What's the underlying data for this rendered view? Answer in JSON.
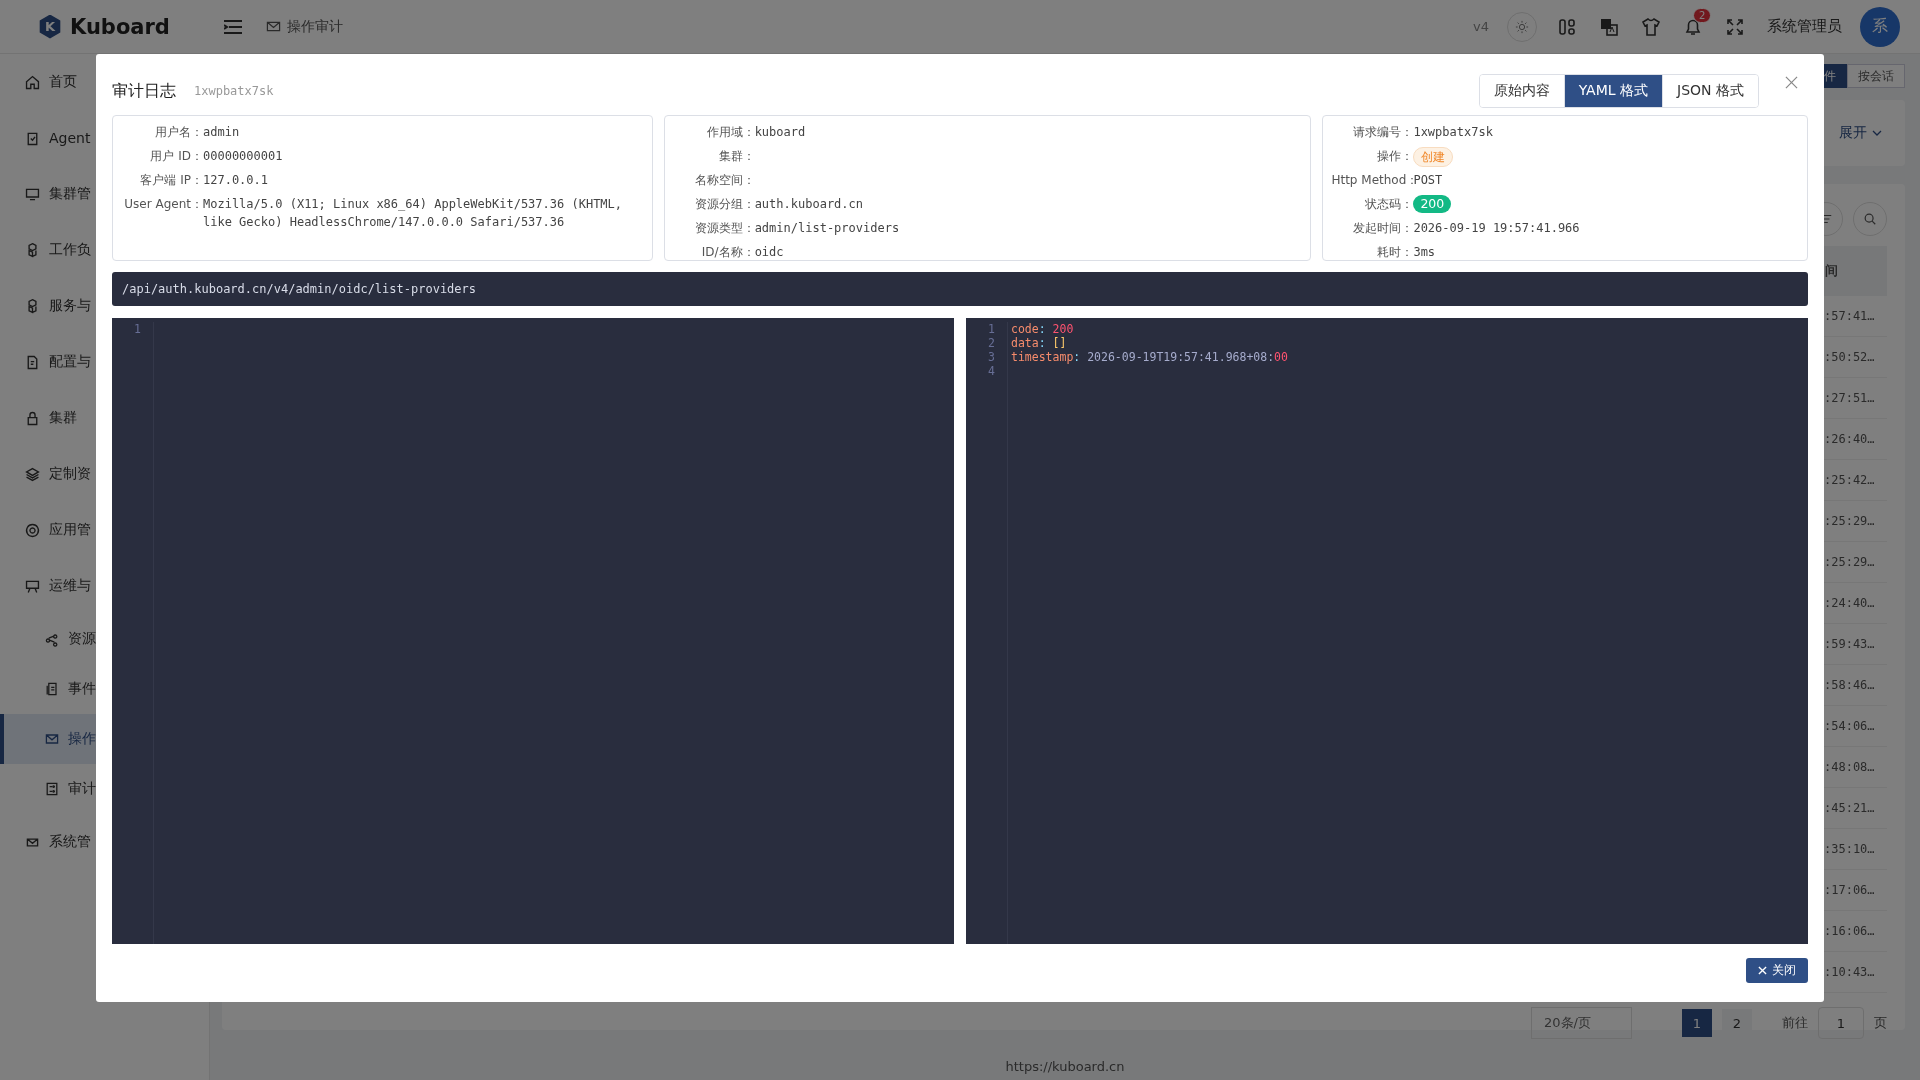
{
  "header": {
    "logo_mark": "K",
    "logo": "Kuboard",
    "breadcrumb": "操作审计",
    "version": "v4",
    "notifications": "2",
    "user": "系统管理员",
    "avatar": "系"
  },
  "sidebar": {
    "items": [
      {
        "label": "首页",
        "selected": false
      },
      {
        "label": "Agent",
        "selected": false
      },
      {
        "label": "集群管",
        "selected": false
      },
      {
        "label": "工作负",
        "selected": false
      },
      {
        "label": "服务与",
        "selected": false
      },
      {
        "label": "配置与",
        "selected": false
      },
      {
        "label": "集群",
        "selected": false
      },
      {
        "label": "定制资",
        "selected": false
      },
      {
        "label": "应用管",
        "selected": false
      },
      {
        "label": "运维与",
        "selected": false,
        "children": [
          {
            "label": "资源",
            "selected": false
          },
          {
            "label": "事件",
            "selected": false
          },
          {
            "label": "操作",
            "selected": true
          },
          {
            "label": "审计",
            "selected": false
          }
        ]
      },
      {
        "label": "系统管",
        "selected": false
      }
    ]
  },
  "background": {
    "view_tabs": [
      {
        "label": "件",
        "selected": true
      },
      {
        "label": "按会话",
        "selected": false
      }
    ],
    "expand": "展开",
    "table": {
      "header": "间",
      "rows": [
        ":57:41…",
        ":50:52…",
        ":27:51…",
        ":26:40…",
        ":25:42…",
        ":25:29…",
        ":25:29…",
        ":24:40…",
        ":59:43…",
        ":58:46…",
        ":54:06…",
        ":48:08…",
        ":45:21…",
        ":35:10…",
        ":17:06…",
        ":16:06…",
        ":10:43…"
      ]
    },
    "pagination": {
      "page_size": "20条/页",
      "pages": [
        {
          "label": "1",
          "selected": true
        },
        {
          "label": "2",
          "selected": false
        }
      ],
      "goto": "前往",
      "goto_value": "1",
      "goto_unit": "页"
    },
    "footer": "https://kuboard.cn"
  },
  "modal": {
    "title": "审计日志",
    "request_id": "1xwpbatx7sk",
    "tabs": [
      {
        "label": "原始内容",
        "selected": false
      },
      {
        "label": "YAML 格式",
        "selected": true
      },
      {
        "label": "JSON 格式",
        "selected": false
      }
    ],
    "info_cards": [
      [
        {
          "label": "用户名：",
          "value": "admin"
        },
        {
          "label": "用户 ID：",
          "value": "00000000001"
        },
        {
          "label": "客户端 IP：",
          "value": "127.0.0.1"
        },
        {
          "label": "User Agent：",
          "value": "Mozilla/5.0 (X11; Linux x86_64) AppleWebKit/537.36 (KHTML, like Gecko) HeadlessChrome/147.0.0.0 Safari/537.36"
        }
      ],
      [
        {
          "label": "作用域：",
          "value": "kuboard"
        },
        {
          "label": "集群："
        },
        {
          "label": "名称空间："
        },
        {
          "label": "资源分组：",
          "value": "auth.kuboard.cn"
        },
        {
          "label": "资源类型：",
          "value": "admin/list-providers"
        },
        {
          "label": "ID/名称：",
          "value": "oidc"
        }
      ],
      [
        {
          "label": "请求编号：",
          "value": "1xwpbatx7sk"
        },
        {
          "label": "操作：",
          "value": "创建",
          "kind": "warning-tag"
        },
        {
          "label": "Http Method：",
          "value": "POST"
        },
        {
          "label": "状态码：",
          "value": "200",
          "kind": "success-tag"
        },
        {
          "label": "发起时间：",
          "value": "2026-09-19 19:57:41.966"
        },
        {
          "label": "耗时：",
          "value": "3ms"
        }
      ]
    ],
    "url": "/api/auth.kuboard.cn/v4/admin/oidc/list-providers",
    "editors": [
      {
        "lines": [
          {
            "number": "1"
          }
        ]
      },
      {
        "lines": [
          {
            "number": "1",
            "tokens": [
              {
                "text": "code",
                "kind": "key"
              },
              {
                "text": ": ",
                "kind": "punct"
              },
              {
                "text": "200",
                "kind": "number"
              }
            ]
          },
          {
            "number": "2",
            "tokens": [
              {
                "text": "data",
                "kind": "key"
              },
              {
                "text": ": ",
                "kind": "punct"
              },
              {
                "text": "[]",
                "kind": "bracket"
              }
            ]
          },
          {
            "number": "3",
            "tokens": [
              {
                "text": "timestamp",
                "kind": "key"
              },
              {
                "text": ": ",
                "kind": "punct"
              },
              {
                "text": "2026-09-19T19:57:41.968+08:",
                "kind": "plain"
              },
              {
                "text": "00",
                "kind": "number"
              }
            ]
          },
          {
            "number": "4"
          }
        ]
      }
    ],
    "close_button": "关闭"
  }
}
